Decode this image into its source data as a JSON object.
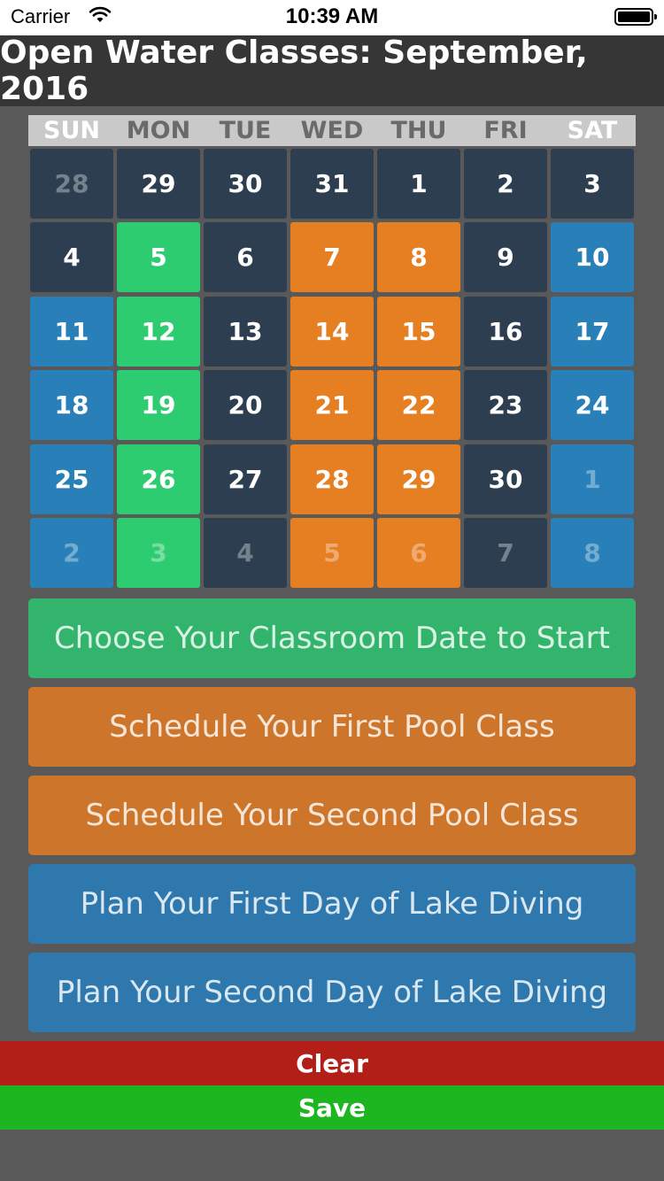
{
  "status_bar": {
    "carrier": "Carrier",
    "time": "10:39 AM"
  },
  "header": {
    "title": "Open Water Classes: September, 2016"
  },
  "calendar": {
    "weekdays": [
      "SUN",
      "MON",
      "TUE",
      "WED",
      "THU",
      "FRI",
      "SAT"
    ],
    "colors": {
      "dark": "#2c3e50",
      "green": "#2ecc71",
      "orange": "#e67e22",
      "blue": "#2980b9"
    },
    "weeks": [
      [
        {
          "label": "28",
          "color": "dark",
          "muted": true
        },
        {
          "label": "29",
          "color": "dark",
          "muted": false
        },
        {
          "label": "30",
          "color": "dark",
          "muted": false
        },
        {
          "label": "31",
          "color": "dark",
          "muted": false
        },
        {
          "label": "1",
          "color": "dark",
          "muted": false
        },
        {
          "label": "2",
          "color": "dark",
          "muted": false
        },
        {
          "label": "3",
          "color": "dark",
          "muted": false
        }
      ],
      [
        {
          "label": "4",
          "color": "dark",
          "muted": false
        },
        {
          "label": "5",
          "color": "green",
          "muted": false
        },
        {
          "label": "6",
          "color": "dark",
          "muted": false
        },
        {
          "label": "7",
          "color": "orange",
          "muted": false
        },
        {
          "label": "8",
          "color": "orange",
          "muted": false
        },
        {
          "label": "9",
          "color": "dark",
          "muted": false
        },
        {
          "label": "10",
          "color": "blue",
          "muted": false
        }
      ],
      [
        {
          "label": "11",
          "color": "blue",
          "muted": false
        },
        {
          "label": "12",
          "color": "green",
          "muted": false
        },
        {
          "label": "13",
          "color": "dark",
          "muted": false
        },
        {
          "label": "14",
          "color": "orange",
          "muted": false
        },
        {
          "label": "15",
          "color": "orange",
          "muted": false
        },
        {
          "label": "16",
          "color": "dark",
          "muted": false
        },
        {
          "label": "17",
          "color": "blue",
          "muted": false
        }
      ],
      [
        {
          "label": "18",
          "color": "blue",
          "muted": false
        },
        {
          "label": "19",
          "color": "green",
          "muted": false
        },
        {
          "label": "20",
          "color": "dark",
          "muted": false
        },
        {
          "label": "21",
          "color": "orange",
          "muted": false
        },
        {
          "label": "22",
          "color": "orange",
          "muted": false
        },
        {
          "label": "23",
          "color": "dark",
          "muted": false
        },
        {
          "label": "24",
          "color": "blue",
          "muted": false
        }
      ],
      [
        {
          "label": "25",
          "color": "blue",
          "muted": false
        },
        {
          "label": "26",
          "color": "green",
          "muted": false
        },
        {
          "label": "27",
          "color": "dark",
          "muted": false
        },
        {
          "label": "28",
          "color": "orange",
          "muted": false
        },
        {
          "label": "29",
          "color": "orange",
          "muted": false
        },
        {
          "label": "30",
          "color": "dark",
          "muted": false
        },
        {
          "label": "1",
          "color": "blue",
          "muted": true
        }
      ],
      [
        {
          "label": "2",
          "color": "blue",
          "muted": true
        },
        {
          "label": "3",
          "color": "green",
          "muted": true
        },
        {
          "label": "4",
          "color": "dark",
          "muted": true
        },
        {
          "label": "5",
          "color": "orange",
          "muted": true
        },
        {
          "label": "6",
          "color": "orange",
          "muted": true
        },
        {
          "label": "7",
          "color": "dark",
          "muted": true
        },
        {
          "label": "8",
          "color": "blue",
          "muted": true
        }
      ]
    ]
  },
  "actions": {
    "classroom": "Choose Your Classroom Date to Start",
    "first_pool": "Schedule Your First Pool Class",
    "second_pool": "Schedule Your Second Pool Class",
    "first_lake": "Plan Your First Day of Lake Diving",
    "second_lake": "Plan Your Second Day of Lake Diving"
  },
  "footer": {
    "clear_label": "Clear",
    "save_label": "Save"
  }
}
